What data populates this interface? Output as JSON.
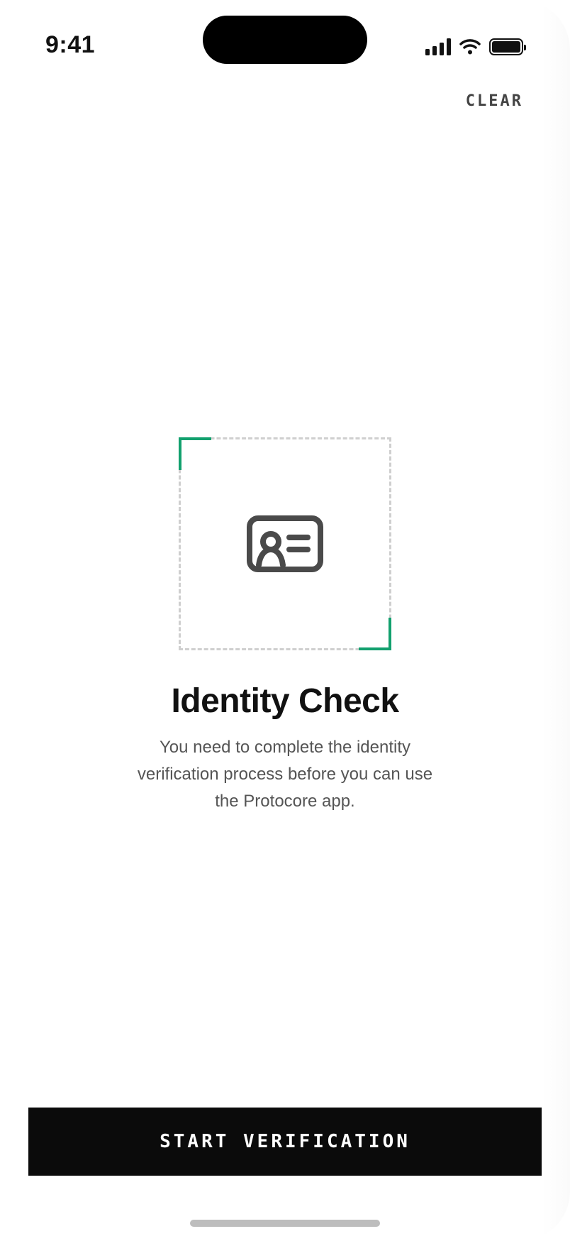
{
  "status_bar": {
    "time": "9:41",
    "icons": [
      "signal-icon",
      "wifi-icon",
      "battery-icon"
    ]
  },
  "header": {
    "clear_label": "CLEAR"
  },
  "scan_frame": {
    "icon": "id-card-icon",
    "accent_color": "#12a06e"
  },
  "content": {
    "title": "Identity Check",
    "description": "You need to complete the identity verification process before you can use the Protocore app."
  },
  "cta": {
    "label": "START VERIFICATION",
    "background": "#0b0b0b"
  }
}
